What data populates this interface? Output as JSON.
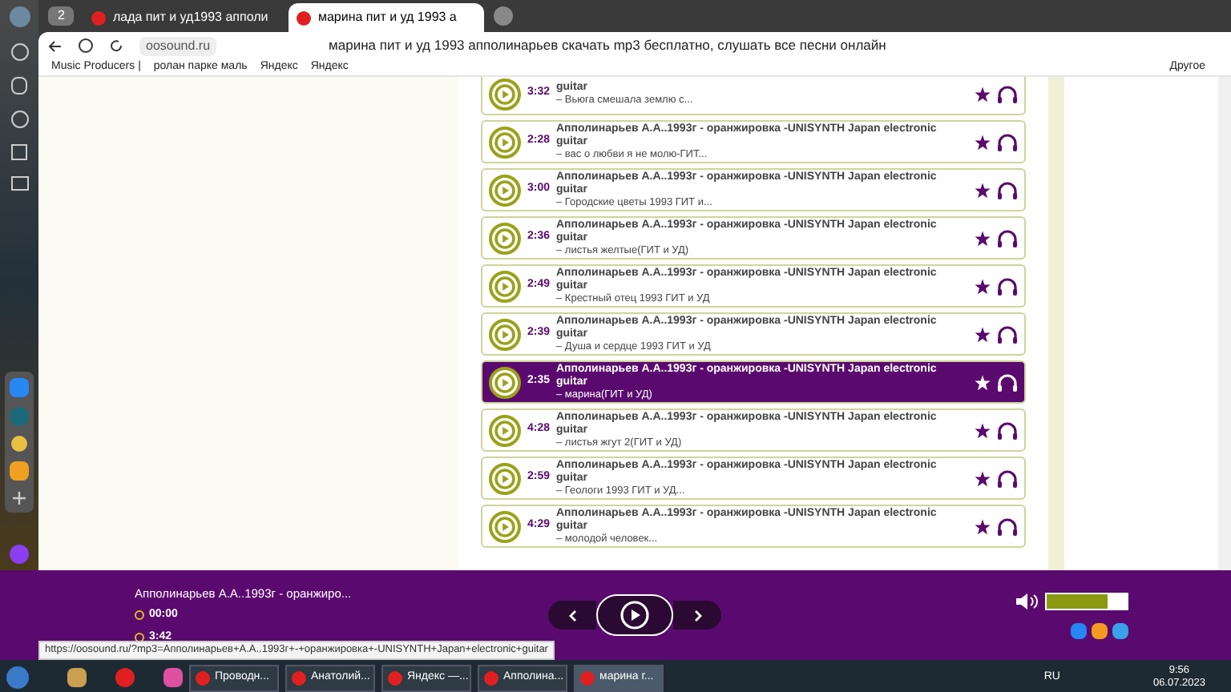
{
  "browser": {
    "tab_count": "2",
    "tabs": [
      {
        "title": "лада пит и уд1993 апполи",
        "selected": false
      },
      {
        "title": "марина пит и уд 1993 а",
        "selected": true
      }
    ],
    "address": "oosound.ru",
    "page_title": "марина пит и уд 1993 апполинарьев скачать mp3 бесплатно, слушать все песни онлайн",
    "bookmarks": [
      "Music Producers |",
      "ролан парке маль",
      "Яндекс",
      "Яндекс"
    ],
    "bookmarks_other": "Другое"
  },
  "tracks": [
    {
      "duration": "3:32",
      "title": "guitar",
      "subtitle": "– Вьюга смешала землю с...",
      "selected": false
    },
    {
      "duration": "2:28",
      "title": "Апполинарьев А.А..1993г - оранжировка -UNISYNTH Japan electronic guitar",
      "subtitle": "– вас о любви я не молю-ГИТ...",
      "selected": false
    },
    {
      "duration": "3:00",
      "title": "Апполинарьев А.А..1993г - оранжировка -UNISYNTH Japan electronic guitar",
      "subtitle": "– Городские цветы 1993 ГИТ и...",
      "selected": false
    },
    {
      "duration": "2:36",
      "title": "Апполинарьев А.А..1993г - оранжировка -UNISYNTH Japan electronic guitar",
      "subtitle": "– листья желтые(ГИТ и УД)",
      "selected": false
    },
    {
      "duration": "2:49",
      "title": "Апполинарьев А.А..1993г - оранжировка -UNISYNTH Japan electronic guitar",
      "subtitle": "– Крестный отец 1993 ГИТ и УД",
      "selected": false
    },
    {
      "duration": "2:39",
      "title": "Апполинарьев А.А..1993г - оранжировка -UNISYNTH Japan electronic guitar",
      "subtitle": "– Душа и сердце 1993 ГИТ и УД",
      "selected": false
    },
    {
      "duration": "2:35",
      "title": "Апполинарьев А.А..1993г - оранжировка -UNISYNTH Japan electronic guitar",
      "subtitle": "– марина(ГИТ и УД)",
      "selected": true
    },
    {
      "duration": "4:28",
      "title": "Апполинарьев А.А..1993г - оранжировка -UNISYNTH Japan electronic guitar",
      "subtitle": "– листья жгут 2(ГИТ и УД)",
      "selected": false
    },
    {
      "duration": "2:59",
      "title": "Апполинарьев А.А..1993г - оранжировка -UNISYNTH Japan electronic guitar",
      "subtitle": "– Геологи 1993 ГИТ и УД...",
      "selected": false
    },
    {
      "duration": "4:29",
      "title": "Апполинарьев А.А..1993г - оранжировка -UNISYNTH Japan electronic guitar",
      "subtitle": "– молодой человек...",
      "selected": false
    }
  ],
  "player": {
    "title": "Апполинарьев А.А..1993г - оранжиро...",
    "elapsed": "00:00",
    "total": "3:42",
    "volume": {
      "level": 0.75
    }
  },
  "status_url": "https://oosound.ru/?mp3=Апполинарьев+А.А..1993г+-+оранжировка+-UNISYNTH+Japan+electronic+guitar",
  "taskbar": {
    "windows": [
      {
        "title": "Проводн...",
        "selected": false
      },
      {
        "title": "Анатолий...",
        "selected": false
      },
      {
        "title": "Яндекс —...",
        "selected": false
      },
      {
        "title": "Апполина...",
        "selected": false
      },
      {
        "title": "марина г...",
        "selected": true
      }
    ],
    "language": "RU",
    "time": "9:56",
    "date": "06.07.2023"
  }
}
